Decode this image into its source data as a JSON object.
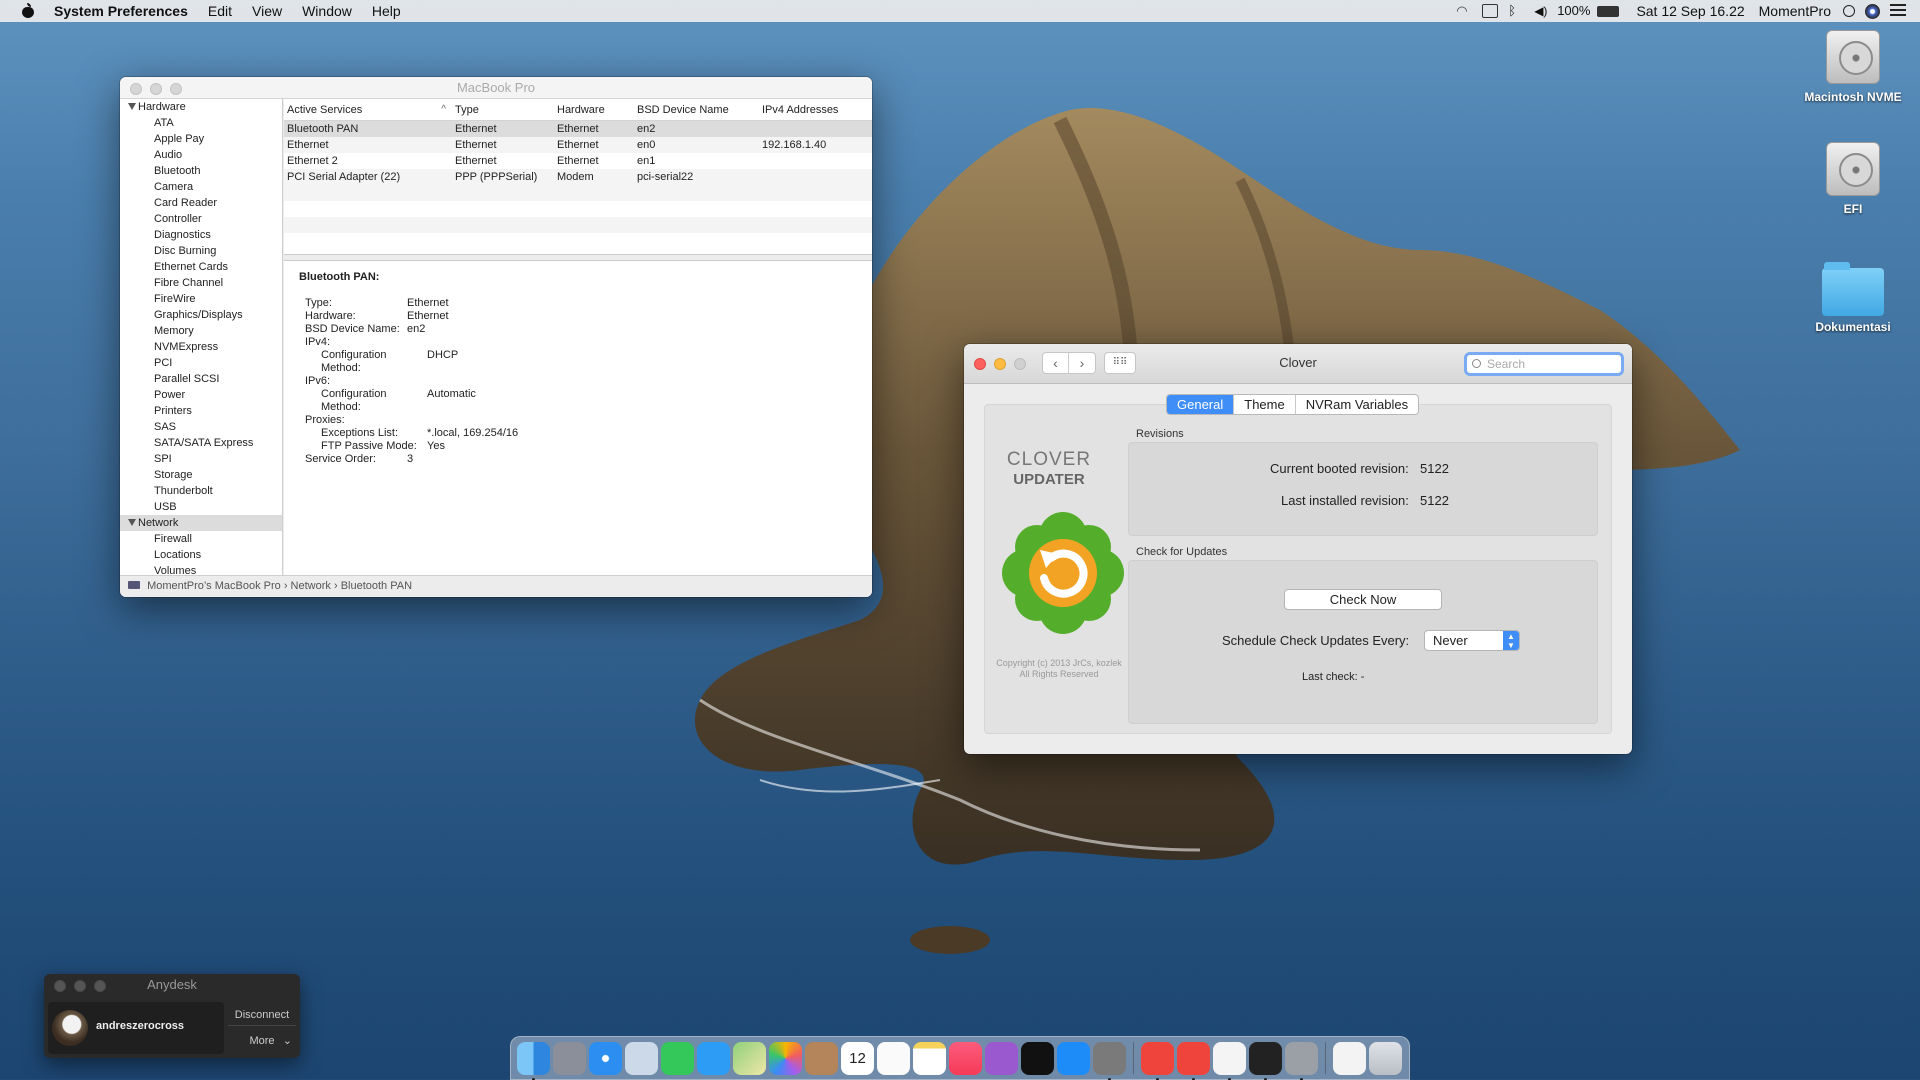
{
  "menubar": {
    "app_name": "System Preferences",
    "menus": [
      "Edit",
      "View",
      "Window",
      "Help"
    ],
    "battery": "100%",
    "datetime": "Sat 12 Sep  16.22",
    "user": "MomentPro"
  },
  "desktop": {
    "icons": [
      {
        "label": "Macintosh NVME",
        "kind": "drive"
      },
      {
        "label": "EFI",
        "kind": "drive"
      },
      {
        "label": "Dokumentasi",
        "kind": "folder"
      }
    ]
  },
  "sysinfo": {
    "window_title": "MacBook Pro",
    "sidebar": {
      "hardware_group": "Hardware",
      "hardware_items": [
        "ATA",
        "Apple Pay",
        "Audio",
        "Bluetooth",
        "Camera",
        "Card Reader",
        "Controller",
        "Diagnostics",
        "Disc Burning",
        "Ethernet Cards",
        "Fibre Channel",
        "FireWire",
        "Graphics/Displays",
        "Memory",
        "NVMExpress",
        "PCI",
        "Parallel SCSI",
        "Power",
        "Printers",
        "SAS",
        "SATA/SATA Express",
        "SPI",
        "Storage",
        "Thunderbolt",
        "USB"
      ],
      "network_group": "Network",
      "network_items": [
        "Firewall",
        "Locations",
        "Volumes"
      ]
    },
    "table": {
      "headers": [
        "Active Services",
        "Type",
        "Hardware",
        "BSD Device Name",
        "IPv4 Addresses"
      ],
      "rows": [
        [
          "Bluetooth PAN",
          "Ethernet",
          "Ethernet",
          "en2",
          ""
        ],
        [
          "Ethernet",
          "Ethernet",
          "Ethernet",
          "en0",
          "192.168.1.40"
        ],
        [
          "Ethernet 2",
          "Ethernet",
          "Ethernet",
          "en1",
          ""
        ],
        [
          "PCI Serial Adapter (22)",
          "PPP (PPPSerial)",
          "Modem",
          "pci-serial22",
          ""
        ]
      ]
    },
    "detail": {
      "title": "Bluetooth PAN:",
      "lines": [
        {
          "k": "Type:",
          "v": "Ethernet",
          "indent": 0
        },
        {
          "k": "Hardware:",
          "v": "Ethernet",
          "indent": 0
        },
        {
          "k": "BSD Device Name:",
          "v": "en2",
          "indent": 0
        },
        {
          "k": "IPv4:",
          "v": "",
          "indent": 0
        },
        {
          "k": "Configuration Method:",
          "v": "DHCP",
          "indent": 1
        },
        {
          "k": "IPv6:",
          "v": "",
          "indent": 0
        },
        {
          "k": "Configuration Method:",
          "v": "Automatic",
          "indent": 1
        },
        {
          "k": "Proxies:",
          "v": "",
          "indent": 0
        },
        {
          "k": "Exceptions List:",
          "v": "*.local, 169.254/16",
          "indent": 1
        },
        {
          "k": "FTP Passive Mode:",
          "v": "Yes",
          "indent": 1
        },
        {
          "k": "Service Order:",
          "v": "3",
          "indent": 0
        }
      ]
    },
    "pathbar": [
      "MomentPro’s MacBook Pro",
      "Network",
      "Bluetooth PAN"
    ]
  },
  "clover": {
    "window_title": "Clover",
    "search_placeholder": "Search",
    "tabs": [
      "General",
      "Theme",
      "NVRam Variables"
    ],
    "logo_line1": "CLOVER",
    "logo_line2": "UPDATER",
    "copyright": "Copyright (c) 2013 JrCs, kozlek\nAll Rights Reserved",
    "revisions_label": "Revisions",
    "current_booted_label": "Current booted revision:",
    "current_booted_value": "5122",
    "last_installed_label": "Last installed revision:",
    "last_installed_value": "5122",
    "check_updates_label": "Check for Updates",
    "check_now": "Check Now",
    "schedule_label": "Schedule Check Updates Every:",
    "schedule_value": "Never",
    "last_check": "Last check: -"
  },
  "anydesk": {
    "title": "Anydesk",
    "user": "andreszerocross",
    "disconnect": "Disconnect",
    "more": "More"
  },
  "dock": {
    "icons": [
      "finder-icon",
      "launchpad-icon",
      "safari-icon",
      "preview-icon",
      "facetime-icon",
      "messages-icon",
      "maps-icon",
      "photos-icon",
      "contacts-icon",
      "calendar-icon",
      "reminders-icon",
      "notes-icon",
      "music-icon",
      "podcasts-icon",
      "tv-icon",
      "app-store-icon",
      "system-preferences-icon",
      "anydesk-icon",
      "anydesk-2-icon",
      "textedit-icon",
      "terminal-icon",
      "clover-configurator-icon",
      "documents-icon",
      "trash-icon"
    ],
    "calendar_day": "12"
  }
}
